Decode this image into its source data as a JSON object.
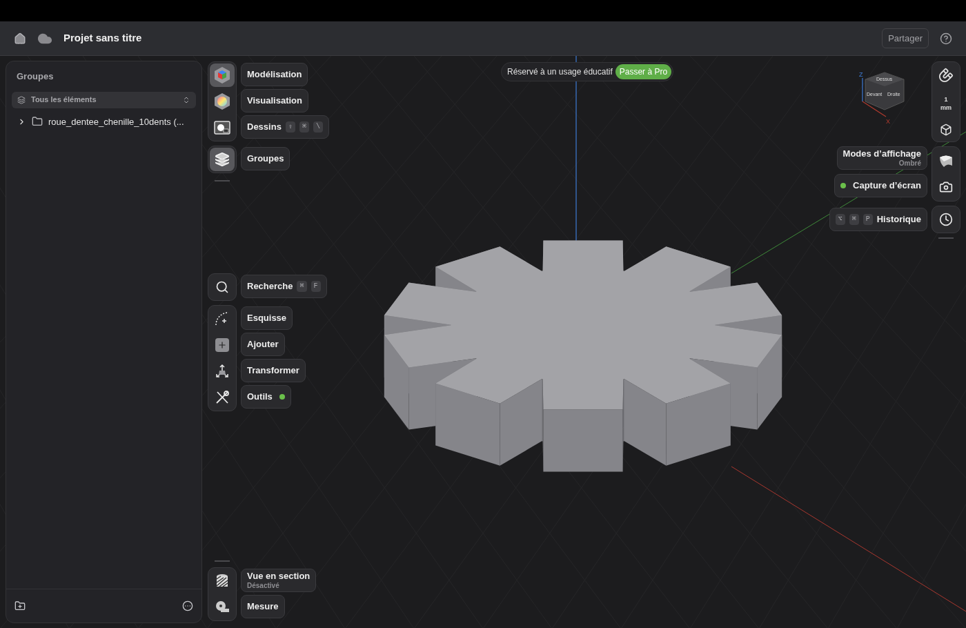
{
  "header": {
    "title": "Projet sans titre",
    "share_button": "Partager"
  },
  "sidebar": {
    "title": "Groupes",
    "filter": "Tous les éléments",
    "tree": [
      {
        "label": "roue_dentee_chenille_10dents (...",
        "expanded": false
      }
    ]
  },
  "banner": {
    "text": "Réservé à un usage éducatif",
    "button": "Passer à Pro"
  },
  "left_toolbar": [
    {
      "tools": [
        {
          "kind": "modeling",
          "label": "Modélisation",
          "selected": true,
          "indicator": false
        },
        {
          "kind": "visualization",
          "label": "Visualisation",
          "selected": false,
          "indicator": false
        },
        {
          "kind": "drawings",
          "label": "Dessins",
          "selected": false,
          "shortcut": [
            "⇧",
            "⌘",
            "\\"
          ],
          "indicator": false
        }
      ]
    },
    {
      "tools": [
        {
          "kind": "layers",
          "label": "Groupes",
          "selected": true,
          "indicator": false
        }
      ]
    },
    {
      "tools": [
        {
          "kind": "search",
          "label": "Recherche",
          "selected": false,
          "shortcut": [
            "⌘",
            "F"
          ],
          "indicator": false
        }
      ]
    },
    {
      "tools": [
        {
          "kind": "sketch",
          "label": "Esquisse",
          "selected": false,
          "indicator": false
        },
        {
          "kind": "add",
          "label": "Ajouter",
          "selected": false,
          "indicator": false
        },
        {
          "kind": "transform",
          "label": "Transformer",
          "selected": false,
          "indicator": false
        },
        {
          "kind": "tools",
          "label": "Outils",
          "selected": false,
          "indicator": true
        }
      ]
    },
    {
      "tools": [
        {
          "kind": "section",
          "label": "Vue en section",
          "sublabel": "Désactivé",
          "selected": false,
          "indicator": false
        },
        {
          "kind": "measure",
          "label": "Mesure",
          "selected": false,
          "indicator": false
        }
      ]
    }
  ],
  "view_cube": {
    "axis_z": "Z",
    "top": "Dessus",
    "front": "Devant",
    "right": "Droite",
    "axis_x": "X"
  },
  "snap": {
    "value": "1",
    "unit": "mm"
  },
  "right_toolbar": [
    {
      "kind": "shading",
      "label": "Modes d’affichage",
      "sublabel": "Ombré",
      "indicator": false
    },
    {
      "kind": "camera",
      "label": "Capture d’écran",
      "indicator": true
    },
    {
      "kind": "history",
      "label": "Historique",
      "shortcut": [
        "⌥",
        "⌘",
        "P"
      ],
      "indicator": false
    }
  ]
}
